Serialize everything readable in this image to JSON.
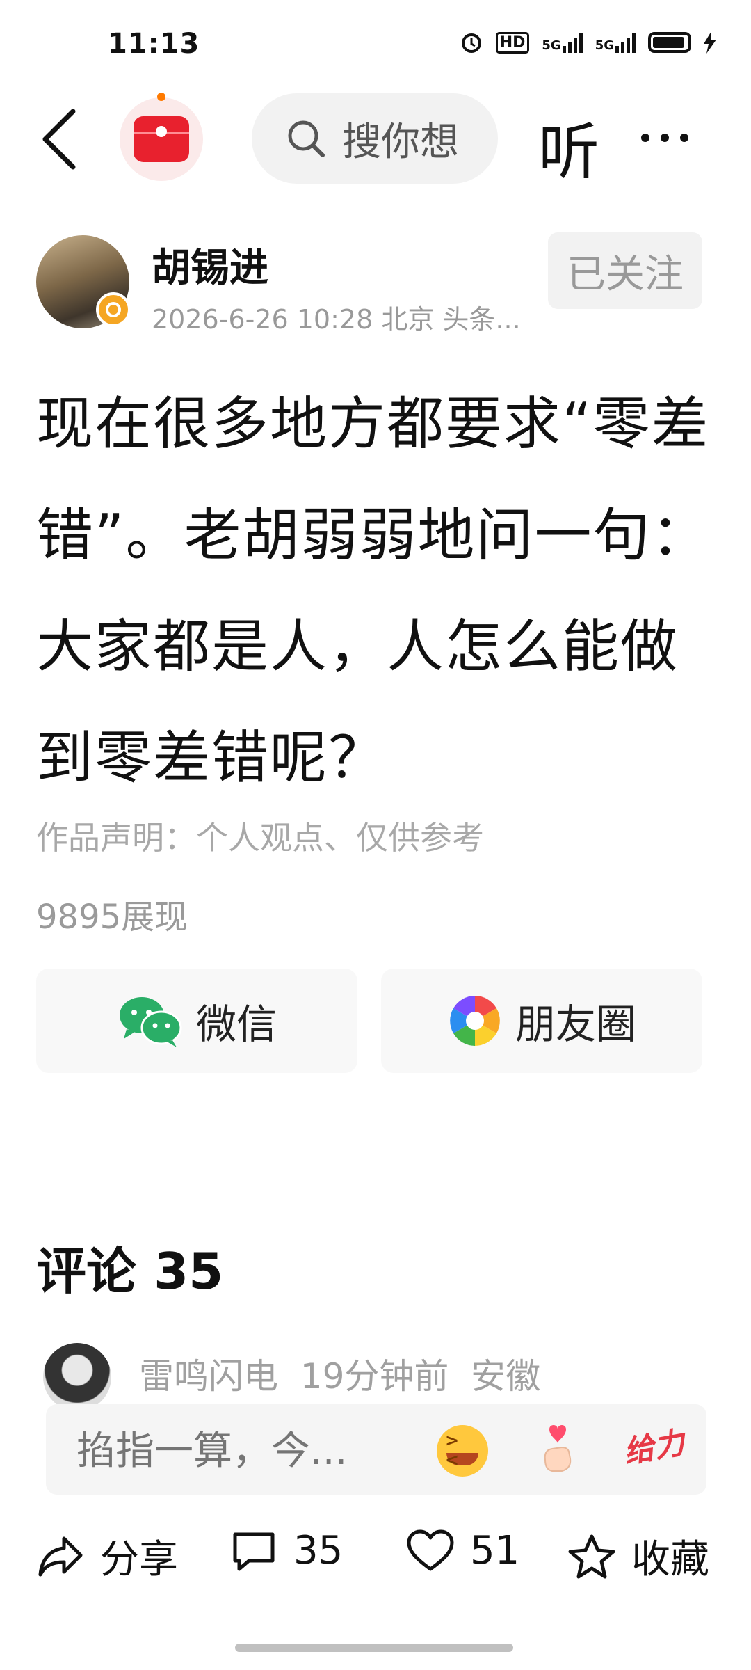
{
  "status_bar": {
    "time": "11:13",
    "hd_label": "HD",
    "net1": "5G",
    "net2": "5G"
  },
  "nav": {
    "back_icon": "chevron-left-icon",
    "app_icon": "red-envelope-icon",
    "search_placeholder": "搜你想",
    "listen_label": "听",
    "more_icon": "more-horizontal-icon"
  },
  "author": {
    "name": "胡锡进",
    "meta": "2026-6-26 10:28 北京 头条...",
    "follow_label": "已关注"
  },
  "post": {
    "text": "现在很多地方都要求“零差错”。老胡弱弱地问一句：大家都是人，人怎么能做到零差错呢？",
    "statement": "作品声明：个人观点、仅供参考",
    "views": "9895展现"
  },
  "share": {
    "wechat_label": "微信",
    "moments_label": "朋友圈"
  },
  "comments": {
    "title": "评论 35",
    "first": {
      "user": "雷鸣闪电",
      "time": "19分钟前",
      "location": "安徽"
    }
  },
  "comment_input": {
    "placeholder": "掐指一算，今...",
    "give_label": "给力"
  },
  "toolbar": {
    "share_label": "分享",
    "comment_count": "35",
    "like_count": "51",
    "favorite_label": "收藏"
  },
  "colors": {
    "brand_red": "#e8212e",
    "wechat_green": "#2aae67",
    "muted_text": "#999999"
  }
}
